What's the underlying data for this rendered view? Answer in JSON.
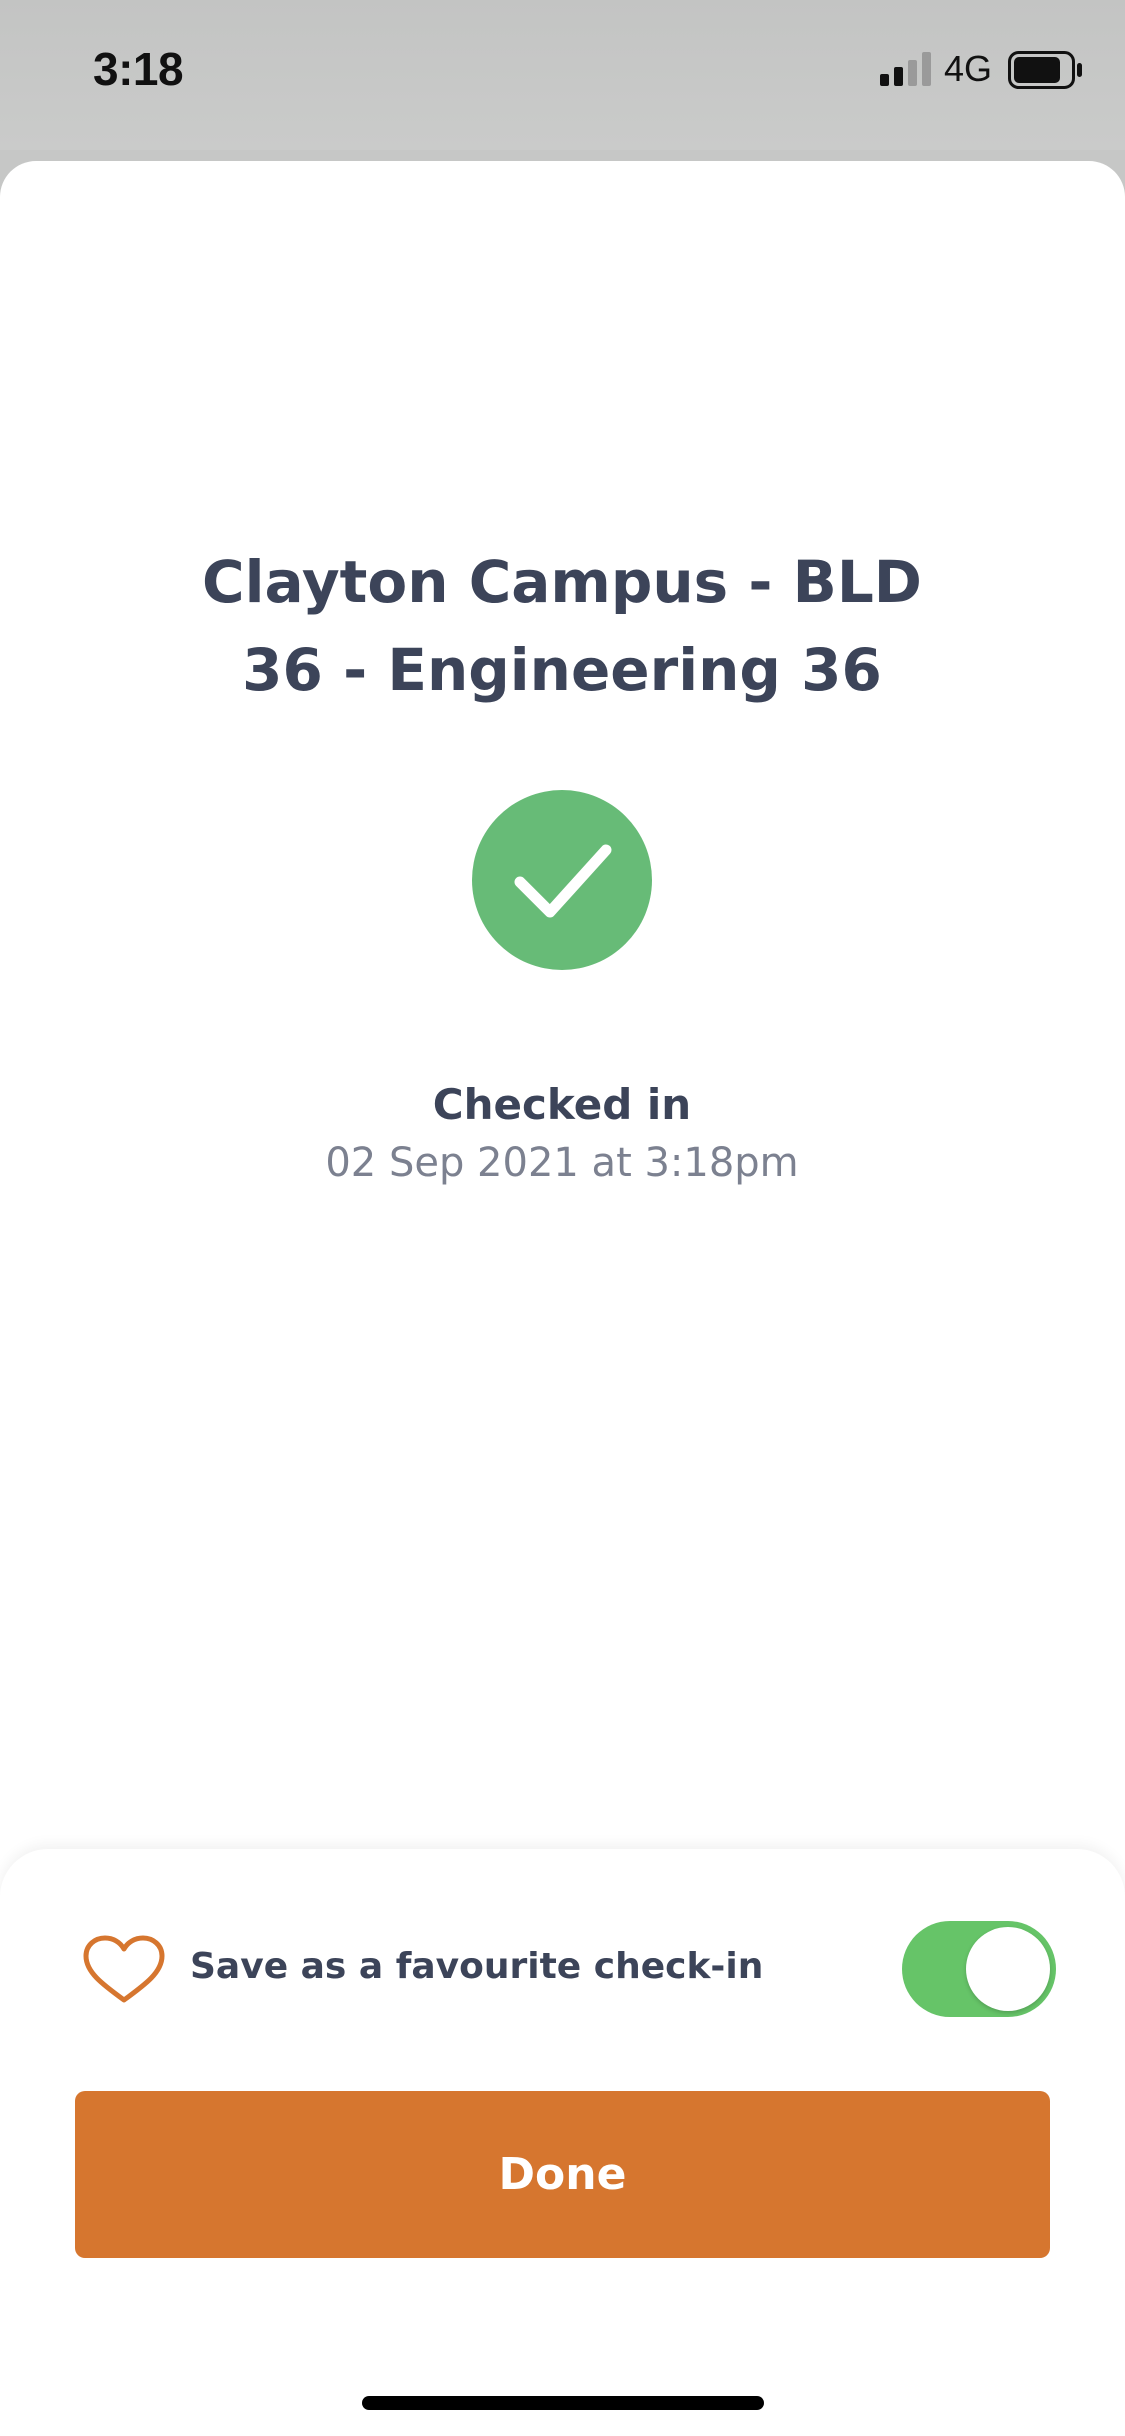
{
  "status_bar": {
    "time": "3:18",
    "network": "4G",
    "signal_icon": "cellular-signal-icon",
    "battery_icon": "battery-icon"
  },
  "checkin": {
    "location_line1": "Clayton Campus - BLD",
    "location_line2": "36 - Engineering 36",
    "status_icon": "checkmark-icon",
    "status": "Checked in",
    "timestamp": "02 Sep 2021 at 3:18pm"
  },
  "favourite": {
    "icon": "heart-icon",
    "label": "Save as a favourite check-in",
    "enabled": true
  },
  "actions": {
    "done_label": "Done"
  },
  "colors": {
    "success": "#67bb77",
    "accent": "#d6762f",
    "toggle_on": "#66c468",
    "text_primary": "#3c4459",
    "text_secondary": "#7c8190"
  }
}
